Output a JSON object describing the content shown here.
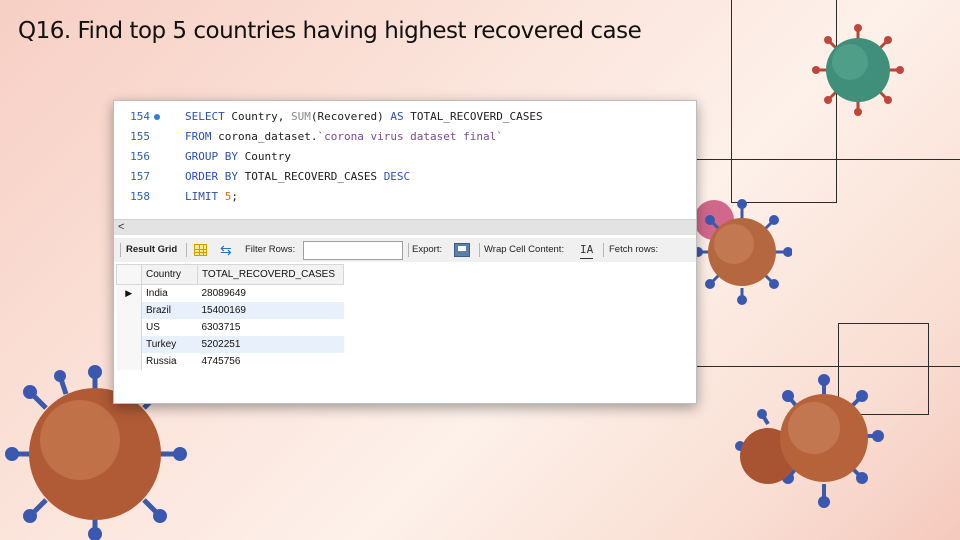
{
  "slide": {
    "title": "Q16. Find top 5 countries having highest recovered case"
  },
  "editor": {
    "lines": [
      {
        "num": "154",
        "executed": true,
        "tokens": [
          {
            "t": "SELECT",
            "c": "kw"
          },
          {
            "t": " Country, ",
            "c": ""
          },
          {
            "t": "SUM",
            "c": "fn"
          },
          {
            "t": "(Recovered) ",
            "c": ""
          },
          {
            "t": "AS",
            "c": "kw"
          },
          {
            "t": " TOTAL_RECOVERD_CASES",
            "c": ""
          }
        ]
      },
      {
        "num": "155",
        "executed": false,
        "tokens": [
          {
            "t": "FROM",
            "c": "kw"
          },
          {
            "t": " corona_dataset.",
            "c": ""
          },
          {
            "t": "`corona virus dataset final`",
            "c": "str"
          }
        ]
      },
      {
        "num": "156",
        "executed": false,
        "tokens": [
          {
            "t": "GROUP BY",
            "c": "kw"
          },
          {
            "t": " Country",
            "c": ""
          }
        ]
      },
      {
        "num": "157",
        "executed": false,
        "tokens": [
          {
            "t": "ORDER BY",
            "c": "kw"
          },
          {
            "t": " TOTAL_RECOVERD_CASES ",
            "c": ""
          },
          {
            "t": "DESC",
            "c": "kw"
          }
        ]
      },
      {
        "num": "158",
        "executed": false,
        "tokens": [
          {
            "t": "LIMIT",
            "c": "kw"
          },
          {
            "t": " ",
            "c": ""
          },
          {
            "t": "5",
            "c": "num"
          },
          {
            "t": ";",
            "c": ""
          }
        ]
      }
    ]
  },
  "scroll": {
    "left_arrow": "<"
  },
  "toolbar": {
    "result_grid": "Result Grid",
    "filter_rows": "Filter Rows:",
    "filter_value": "",
    "export": "Export:",
    "wrap_cell": "Wrap Cell Content:",
    "wrap_icon": "IA",
    "fetch_rows": "Fetch rows:"
  },
  "results": {
    "columns": [
      "Country",
      "TOTAL_RECOVERD_CASES"
    ],
    "rows": [
      {
        "country": "India",
        "total": "28089649",
        "current": true
      },
      {
        "country": "Brazil",
        "total": "15400169",
        "current": false
      },
      {
        "country": "US",
        "total": "6303715",
        "current": false
      },
      {
        "country": "Turkey",
        "total": "5202251",
        "current": false
      },
      {
        "country": "Russia",
        "total": "4745756",
        "current": false
      }
    ]
  },
  "colors": {
    "keyword": "#2b4fb0",
    "line_number": "#2f5fa8",
    "string": "#7a4a9a",
    "number": "#d46a1a",
    "alt_row": "#e8f0fb"
  },
  "icons": [
    "execution-dot-icon",
    "grid-view-icon",
    "refresh-icon",
    "export-icon",
    "wrap-text-icon",
    "row-pointer-icon",
    "virus-illustration"
  ]
}
